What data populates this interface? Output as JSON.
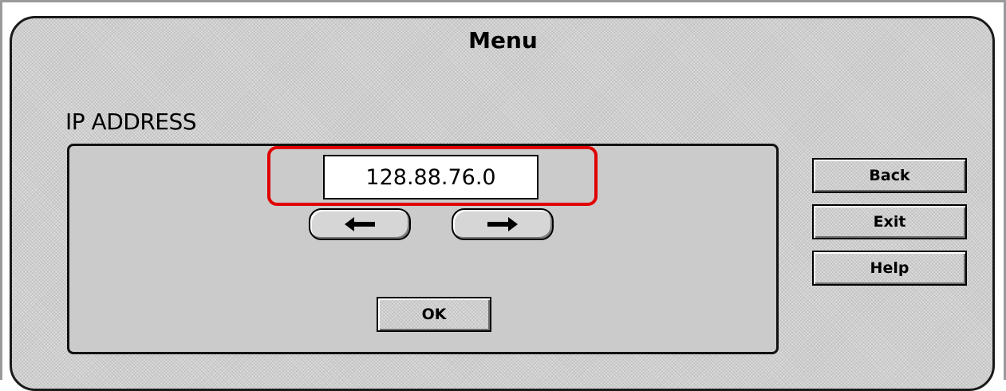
{
  "menu": {
    "title": "Menu",
    "section_label": "IP ADDRESS"
  },
  "ip_field": {
    "value": "128.88.76.0"
  },
  "nav": {
    "left_arrow": "🡄",
    "right_arrow": "🡆",
    "left_icon": "arrow-left-icon",
    "right_icon": "arrow-right-icon"
  },
  "buttons": {
    "ok": "OK",
    "back": "Back",
    "exit": "Exit",
    "help": "Help"
  },
  "colors": {
    "highlight": "#e00000",
    "panel": "#cfcfcf",
    "field_background": "#ffffff"
  }
}
